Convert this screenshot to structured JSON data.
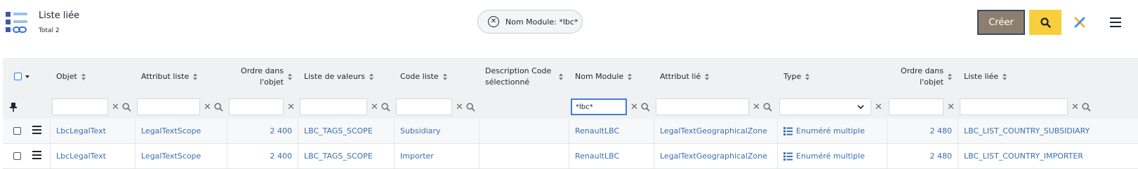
{
  "app": {
    "title": "Liste liée",
    "total": "Total 2",
    "icon": "linked-list-icon"
  },
  "filter_chip": {
    "label": "Nom Module: *lbc*",
    "remove_icon": "close-circle-icon"
  },
  "toolbar": {
    "create_label": "Créer",
    "search_icon": "search-icon",
    "pin_icon": "pin-cross-icon",
    "menu_icon": "hamburger-icon",
    "accent_create": "#8d7f70",
    "accent_search": "#f7cf3c"
  },
  "columns": [
    {
      "key": "objet",
      "label": "Objet"
    },
    {
      "key": "attribut_liste",
      "label": "Attribut liste"
    },
    {
      "key": "ordre",
      "label": "Ordre dans l'objet"
    },
    {
      "key": "liste_valeurs",
      "label": "Liste de valeurs"
    },
    {
      "key": "code_liste",
      "label": "Code liste"
    },
    {
      "key": "description_code",
      "label": "Description Code sélectionné"
    },
    {
      "key": "nom_module",
      "label": "Nom Module"
    },
    {
      "key": "attribut_lie",
      "label": "Attribut lié"
    },
    {
      "key": "type",
      "label": "Type"
    },
    {
      "key": "ordre2",
      "label": "Ordre dans l'objet"
    },
    {
      "key": "liste_liee",
      "label": "Liste liée"
    }
  ],
  "filters": {
    "nom_module": "*lbc*"
  },
  "rows": [
    {
      "objet": "LbcLegalText",
      "attribut_liste": "LegalTextScope",
      "ordre": "2 400",
      "liste_valeurs": "LBC_TAGS_SCOPE",
      "code_liste": "Subsidiary",
      "description_code": "",
      "nom_module": "RenaultLBC",
      "attribut_lie": "LegalTextGeographicalZone",
      "type": "Enuméré multiple",
      "ordre2": "2 480",
      "liste_liee": "LBC_LIST_COUNTRY_SUBSIDIARY"
    },
    {
      "objet": "LbcLegalText",
      "attribut_liste": "LegalTextScope",
      "ordre": "2 400",
      "liste_valeurs": "LBC_TAGS_SCOPE",
      "code_liste": "Importer",
      "description_code": "",
      "nom_module": "RenaultLBC",
      "attribut_lie": "LegalTextGeographicalZone",
      "type": "Enuméré multiple",
      "ordre2": "2 480",
      "liste_liee": "LBC_LIST_COUNTRY_IMPORTER"
    }
  ],
  "colors": {
    "link": "#3a6fb0",
    "header_bg": "#f0f1f3",
    "focus": "#3b7fd8"
  }
}
